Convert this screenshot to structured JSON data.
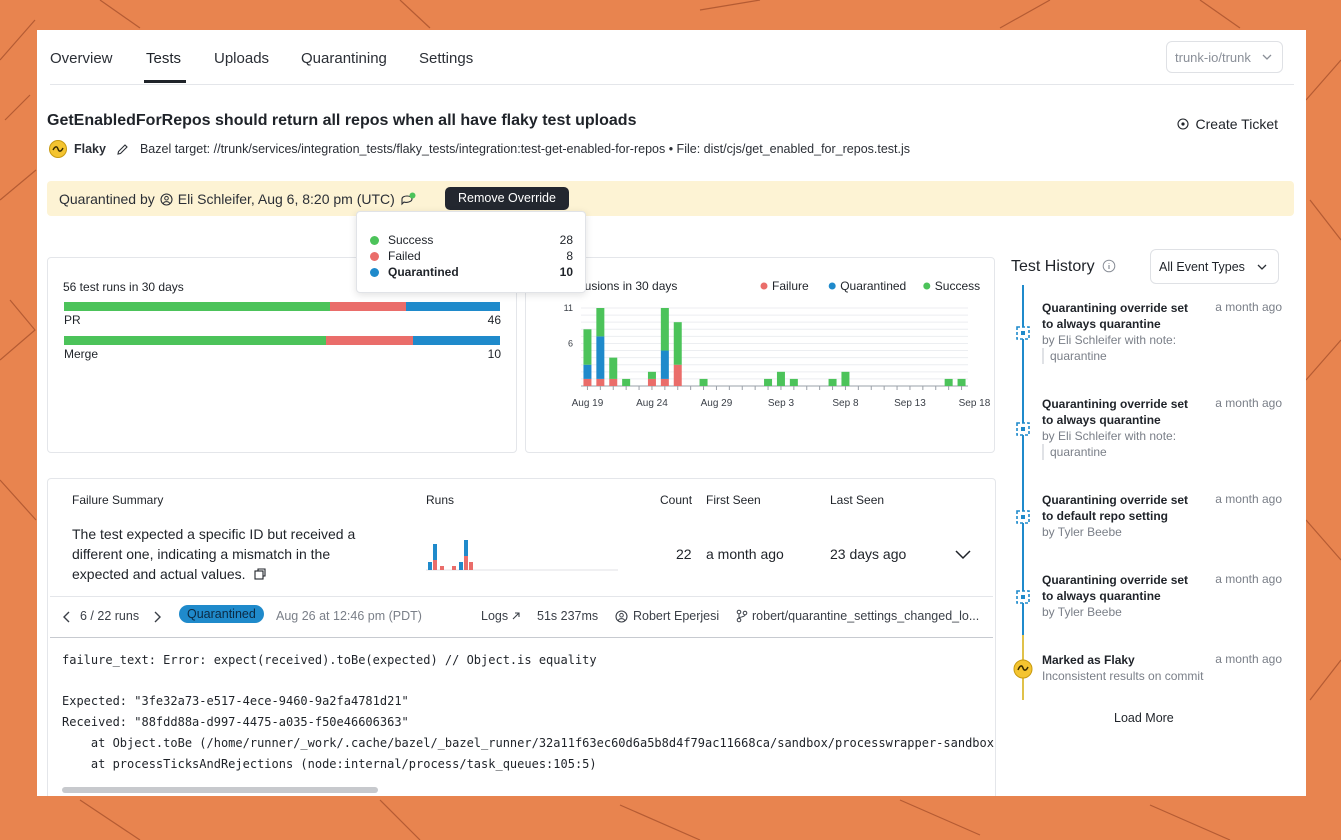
{
  "nav": {
    "tabs": [
      {
        "label": "Overview"
      },
      {
        "label": "Tests"
      },
      {
        "label": "Uploads"
      },
      {
        "label": "Quarantining"
      },
      {
        "label": "Settings"
      }
    ],
    "active_tab": "Tests",
    "repo": "trunk-io/trunk"
  },
  "test": {
    "title": "GetEnabledForRepos should return all repos when all have flaky test uploads",
    "status": "Flaky",
    "meta": "Bazel target: //trunk/services/integration_tests/flaky_tests/integration:test-get-enabled-for-repos • File: dist/cjs/get_enabled_for_repos.test.js",
    "create_ticket": "Create Ticket"
  },
  "banner": {
    "prefix": "Quarantined by",
    "user_and_time": "Eli Schleifer, Aug 6, 8:20 pm (UTC)",
    "remove_button": "Remove Override"
  },
  "tooltip": {
    "rows": [
      {
        "label": "Success",
        "value": "28",
        "color": "#4cc35a"
      },
      {
        "label": "Failed",
        "value": "8",
        "color": "#ea6d6a"
      },
      {
        "label": "Quarantined",
        "value": "10",
        "color": "#1f8acb"
      }
    ]
  },
  "runs_card": {
    "title": "56 test runs in 30 days",
    "bars": [
      {
        "label": "PR",
        "count": "46",
        "success": 0.61,
        "failed": 0.175,
        "quarantined": 0.215
      },
      {
        "label": "Merge",
        "count": "10",
        "success": 0.6,
        "failed": 0.2,
        "quarantined": 0.2
      }
    ]
  },
  "chart_data": {
    "type": "bar",
    "title": "Inclusions in 30 days",
    "series": [
      {
        "name": "Failure",
        "color": "#ea6d6a"
      },
      {
        "name": "Quarantined",
        "color": "#1f8acb"
      },
      {
        "name": "Success",
        "color": "#4cc35a"
      }
    ],
    "xticks": [
      "Aug 19",
      "Aug 24",
      "Aug 29",
      "Sep 3",
      "Sep 8",
      "Sep 13",
      "Sep 18"
    ],
    "yticks": [
      6,
      11
    ],
    "ylim": [
      0,
      11
    ],
    "days": [
      {
        "f": 1,
        "q": 2,
        "s": 5
      },
      {
        "f": 1,
        "q": 6,
        "s": 4
      },
      {
        "f": 1,
        "q": 0,
        "s": 3
      },
      {
        "f": 0,
        "q": 0,
        "s": 1
      },
      {
        "f": 0,
        "q": 0,
        "s": 0
      },
      {
        "f": 1,
        "q": 0,
        "s": 1
      },
      {
        "f": 1,
        "q": 4,
        "s": 6
      },
      {
        "f": 3,
        "q": 0,
        "s": 6
      },
      {
        "f": 0,
        "q": 0,
        "s": 0
      },
      {
        "f": 0,
        "q": 0,
        "s": 1
      },
      {
        "f": 0,
        "q": 0,
        "s": 0
      },
      {
        "f": 0,
        "q": 0,
        "s": 0
      },
      {
        "f": 0,
        "q": 0,
        "s": 0
      },
      {
        "f": 0,
        "q": 0,
        "s": 0
      },
      {
        "f": 0,
        "q": 0,
        "s": 1
      },
      {
        "f": 0,
        "q": 0,
        "s": 2
      },
      {
        "f": 0,
        "q": 0,
        "s": 1
      },
      {
        "f": 0,
        "q": 0,
        "s": 0
      },
      {
        "f": 0,
        "q": 0,
        "s": 0
      },
      {
        "f": 0,
        "q": 0,
        "s": 1
      },
      {
        "f": 0,
        "q": 0,
        "s": 2
      },
      {
        "f": 0,
        "q": 0,
        "s": 0
      },
      {
        "f": 0,
        "q": 0,
        "s": 0
      },
      {
        "f": 0,
        "q": 0,
        "s": 0
      },
      {
        "f": 0,
        "q": 0,
        "s": 0
      },
      {
        "f": 0,
        "q": 0,
        "s": 0
      },
      {
        "f": 0,
        "q": 0,
        "s": 0
      },
      {
        "f": 0,
        "q": 0,
        "s": 0
      },
      {
        "f": 0,
        "q": 0,
        "s": 1
      },
      {
        "f": 0,
        "q": 0,
        "s": 1
      }
    ]
  },
  "history": {
    "title": "Test History",
    "filter": "All Event Types",
    "items": [
      {
        "head": "Quarantining override set to always quarantine",
        "time": "a month ago",
        "sub": "by Eli Schleifer with note:",
        "note": "quarantine"
      },
      {
        "head": "Quarantining override set to always quarantine",
        "time": "a month ago",
        "sub": "by Eli Schleifer with note:",
        "note": "quarantine"
      },
      {
        "head": "Quarantining override set to default repo setting",
        "time": "a month ago",
        "sub": "by Tyler Beebe"
      },
      {
        "head": "Quarantining override set to always quarantine",
        "time": "a month ago",
        "sub": "by Tyler Beebe"
      },
      {
        "head": "Marked as Flaky",
        "time": "a month ago",
        "sub": "Inconsistent results on commit"
      }
    ],
    "load_more": "Load More"
  },
  "failures": {
    "headers": [
      "Failure Summary",
      "Runs",
      "Count",
      "First Seen",
      "Last Seen"
    ],
    "row": {
      "summary": "The test expected a specific ID but received a different one, indicating a mismatch in the expected and actual values.",
      "count": "22",
      "first_seen": "a month ago",
      "last_seen": "23 days ago"
    },
    "run": {
      "pager": "6 / 22 runs",
      "status": "Quarantined",
      "date": "Aug 26 at 12:46 pm (PDT)",
      "logs": "Logs",
      "duration": "51s 237ms",
      "author": "Robert Eperjesi",
      "branch": "robert/quarantine_settings_changed_lo..."
    },
    "log": "failure_text: Error: expect(received).toBe(expected) // Object.is equality\n\nExpected: \"3fe32a73-e517-4ece-9460-9a2fa4781d21\"\nReceived: \"88fdd88a-d997-4475-a035-f50e46606363\"\n    at Object.toBe (/home/runner/_work/.cache/bazel/_bazel_runner/32a11f63ec60d6a5b8d4f79ac11668ca/sandbox/processwrapper-sandbox\n    at processTicksAndRejections (node:internal/process/task_queues:105:5)"
  }
}
